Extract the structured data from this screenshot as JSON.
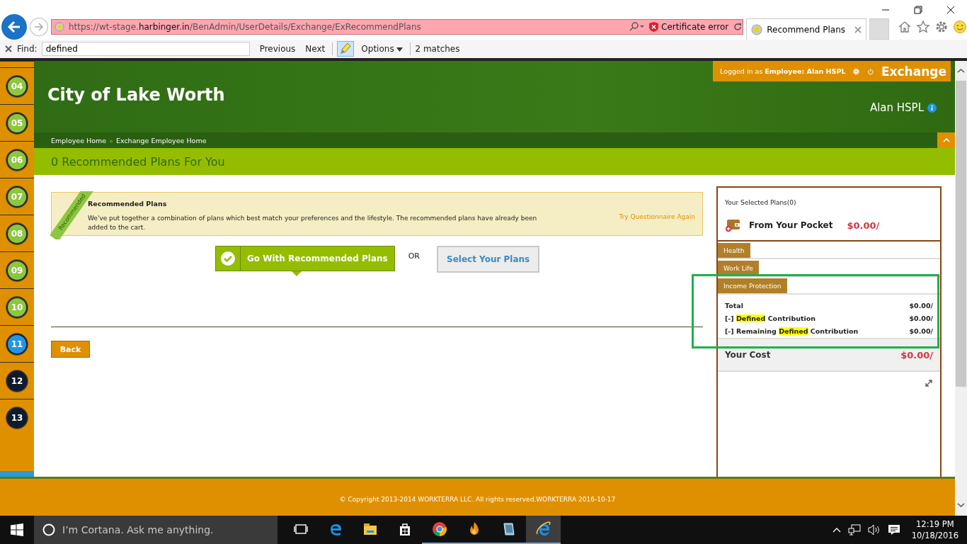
{
  "browser": {
    "address": {
      "prefix": "https://wt-stage.",
      "host": "harbinger.in",
      "path": "/BenAdmin/UserDetails/Exchange/ExRecommendPlans"
    },
    "certificate": "Certificate error",
    "tab_title": "Recommend Plans"
  },
  "find_bar": {
    "label": "Find:",
    "value": "defined",
    "previous": "Previous",
    "next": "Next",
    "highlight": true,
    "options": "Options",
    "matches": "2 matches"
  },
  "steps": [
    {
      "label": "04",
      "completed": true,
      "selected": false
    },
    {
      "label": "05",
      "completed": true,
      "selected": false
    },
    {
      "label": "06",
      "completed": true,
      "selected": false
    },
    {
      "label": "07",
      "completed": true,
      "selected": false
    },
    {
      "label": "08",
      "completed": true,
      "selected": false
    },
    {
      "label": "09",
      "completed": true,
      "selected": false
    },
    {
      "label": "10",
      "completed": true,
      "selected": false
    },
    {
      "label": "11",
      "completed": false,
      "selected": true
    },
    {
      "label": "12",
      "completed": false,
      "selected": false
    },
    {
      "label": "13",
      "completed": false,
      "selected": false
    }
  ],
  "header": {
    "title": "City of Lake Worth",
    "login": "Logged in as **Employee:  Alan HSPL**",
    "app": "Exchange",
    "user": "Alan HSPL",
    "breadcrumb": [
      "Employee Home",
      "Exchange Employee Home"
    ],
    "separator": "»"
  },
  "page_title": "0 Recommended Plans For You",
  "recommendation": {
    "ribbon": "Recommended",
    "title": "Recommended Plans",
    "text": "We've put together a combination of plans which best match your preferences and the lifestyle. The recommended plans have already been added to the cart.",
    "link": "Try Questionnaire Again"
  },
  "actions": {
    "primary": "Go With Recommended Plans",
    "or": "OR",
    "secondary": "Select Your Plans"
  },
  "back": "Back",
  "cart": {
    "title": "Your Selected Plans(0)",
    "pocket_label": "From Your Pocket",
    "pocket_amount": "$0.00/",
    "categories": [
      {
        "label": "Health"
      },
      {
        "label": "Work Life"
      },
      {
        "label": "Income Protection"
      }
    ],
    "rows": [
      {
        "label": [
          {
            "text": "Total",
            "highlighted": false
          }
        ],
        "amount": "$0.00/"
      },
      {
        "label": [
          {
            "text": "[-] ",
            "highlighted": false
          },
          {
            "text": "Defined",
            "highlighted": true
          },
          {
            "text": " Contribution",
            "highlighted": false
          }
        ],
        "amount": "$0.00/"
      },
      {
        "label": [
          {
            "text": "[-] Remaining ",
            "highlighted": false
          },
          {
            "text": "Defined",
            "highlighted": true
          },
          {
            "text": " Contribution",
            "highlighted": false
          }
        ],
        "amount": "$0.00/"
      }
    ],
    "cost_label": "Your Cost",
    "cost_amount": "$0.00/"
  },
  "footer": "© Copyright 2013-2014 WORKTERRA LLC. All rights reserved.WORKTERRA 2016-10-17",
  "taskbar": {
    "search_placeholder": "I’m Cortana. Ask me anything.",
    "apps": [
      {
        "kind": "task-view",
        "running": false,
        "selected": false
      },
      {
        "kind": "edge",
        "running": false,
        "selected": false
      },
      {
        "kind": "explorer",
        "running": false,
        "selected": false
      },
      {
        "kind": "store",
        "running": false,
        "selected": false
      },
      {
        "kind": "chrome",
        "running": true,
        "selected": false
      },
      {
        "kind": "flame",
        "running": true,
        "selected": false
      },
      {
        "kind": "tablet",
        "running": true,
        "selected": false
      },
      {
        "kind": "ie",
        "running": true,
        "selected": true
      }
    ],
    "time": "12:19 PM",
    "date": "10/18/2016"
  }
}
